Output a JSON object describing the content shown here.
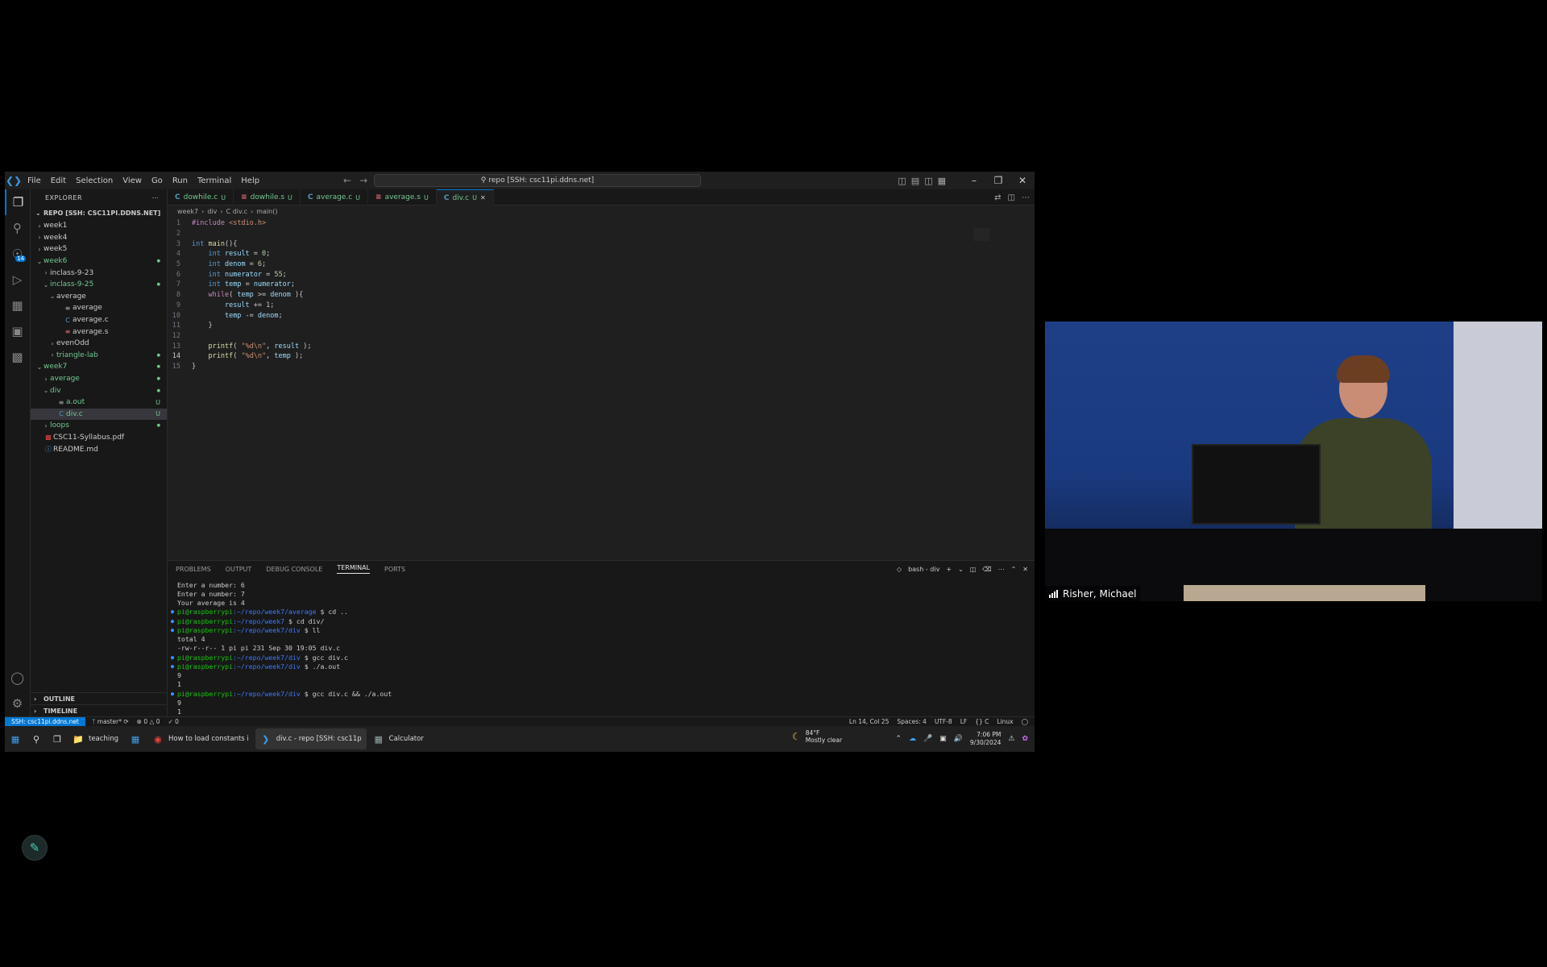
{
  "window": {
    "menu": [
      "File",
      "Edit",
      "Selection",
      "View",
      "Go",
      "Run",
      "Terminal",
      "Help"
    ],
    "command_center": "repo [SSH: csc11pi.ddns.net]"
  },
  "sidebar": {
    "header": "EXPLORER",
    "root": "REPO [SSH: CSC11PI.DDNS.NET]",
    "items": [
      {
        "label": "week1",
        "depth": 0,
        "type": "folder",
        "open": false,
        "status": "",
        "color": "default"
      },
      {
        "label": "week4",
        "depth": 0,
        "type": "folder",
        "open": false,
        "status": "",
        "color": "default"
      },
      {
        "label": "week5",
        "depth": 0,
        "type": "folder",
        "open": false,
        "status": "",
        "color": "default"
      },
      {
        "label": "week6",
        "depth": 0,
        "type": "folder",
        "open": true,
        "status": "●",
        "color": "green"
      },
      {
        "label": "inclass-9-23",
        "depth": 1,
        "type": "folder",
        "open": false,
        "status": "",
        "color": "default"
      },
      {
        "label": "inclass-9-25",
        "depth": 1,
        "type": "folder",
        "open": true,
        "status": "●",
        "color": "green"
      },
      {
        "label": "average",
        "depth": 2,
        "type": "folder",
        "open": true,
        "status": "",
        "color": "default"
      },
      {
        "label": "average",
        "depth": 3,
        "type": "bin",
        "open": false,
        "status": "",
        "color": "default"
      },
      {
        "label": "average.c",
        "depth": 3,
        "type": "c",
        "open": false,
        "status": "",
        "color": "default"
      },
      {
        "label": "average.s",
        "depth": 3,
        "type": "asm",
        "open": false,
        "status": "",
        "color": "default"
      },
      {
        "label": "evenOdd",
        "depth": 2,
        "type": "folder",
        "open": false,
        "status": "",
        "color": "default"
      },
      {
        "label": "triangle-lab",
        "depth": 2,
        "type": "folder",
        "open": false,
        "status": "●",
        "color": "green"
      },
      {
        "label": "week7",
        "depth": 0,
        "type": "folder",
        "open": true,
        "status": "●",
        "color": "green"
      },
      {
        "label": "average",
        "depth": 1,
        "type": "folder",
        "open": false,
        "status": "●",
        "color": "green"
      },
      {
        "label": "div",
        "depth": 1,
        "type": "folder",
        "open": true,
        "status": "●",
        "color": "green"
      },
      {
        "label": "a.out",
        "depth": 2,
        "type": "bin",
        "open": false,
        "status": "U",
        "color": "green"
      },
      {
        "label": "div.c",
        "depth": 2,
        "type": "c",
        "open": false,
        "status": "U",
        "color": "green",
        "selected": true
      },
      {
        "label": "loops",
        "depth": 1,
        "type": "folder",
        "open": false,
        "status": "●",
        "color": "green"
      },
      {
        "label": "CSC11-Syllabus.pdf",
        "depth": 0,
        "type": "pdf",
        "open": false,
        "status": "",
        "color": "default"
      },
      {
        "label": "README.md",
        "depth": 0,
        "type": "md",
        "open": false,
        "status": "",
        "color": "default"
      }
    ],
    "sections": [
      "OUTLINE",
      "TIMELINE"
    ]
  },
  "tabs": [
    {
      "icon": "C",
      "label": "dowhile.c",
      "status": "U",
      "active": false
    },
    {
      "icon": "asm",
      "label": "dowhile.s",
      "status": "U",
      "active": false
    },
    {
      "icon": "C",
      "label": "average.c",
      "status": "U",
      "active": false
    },
    {
      "icon": "asm",
      "label": "average.s",
      "status": "U",
      "active": false
    },
    {
      "icon": "C",
      "label": "div.c",
      "status": "U",
      "active": true
    }
  ],
  "breadcrumb": [
    "week7",
    "div",
    "C div.c",
    "main()"
  ],
  "code": {
    "current_line": 14,
    "lines": [
      "#include <stdio.h>",
      "",
      "int main(){",
      "    int result = 0;",
      "    int denom = 6;",
      "    int numerator = 55;",
      "    int temp = numerator;",
      "    while( temp >= denom ){",
      "        result += 1;",
      "        temp -= denom;",
      "    }",
      "",
      "    printf( \"%d\\n\", result );",
      "    printf( \"%d\\n\", temp );",
      "}"
    ]
  },
  "panel": {
    "tabs": [
      "PROBLEMS",
      "OUTPUT",
      "DEBUG CONSOLE",
      "TERMINAL",
      "PORTS"
    ],
    "active_tab": "TERMINAL",
    "terminal_name": "bash - div",
    "terminal": [
      {
        "type": "text",
        "text": "Enter a number: 6"
      },
      {
        "type": "text",
        "text": "Enter a number: 7"
      },
      {
        "type": "text",
        "text": "Your average is 4"
      },
      {
        "type": "prompt",
        "user": "pi@raspberrypi",
        "path": ":~/repo/week7/average",
        "cmd": " $ cd .."
      },
      {
        "type": "prompt",
        "user": "pi@raspberrypi",
        "path": ":~/repo/week7",
        "cmd": " $ cd div/"
      },
      {
        "type": "prompt",
        "user": "pi@raspberrypi",
        "path": ":~/repo/week7/div",
        "cmd": " $ ll"
      },
      {
        "type": "text",
        "text": "total 4"
      },
      {
        "type": "text",
        "text": "-rw-r--r-- 1 pi pi 231 Sep 30 19:05 div.c"
      },
      {
        "type": "prompt",
        "user": "pi@raspberrypi",
        "path": ":~/repo/week7/div",
        "cmd": " $ gcc div.c"
      },
      {
        "type": "prompt",
        "user": "pi@raspberrypi",
        "path": ":~/repo/week7/div",
        "cmd": " $ ./a.out"
      },
      {
        "type": "text",
        "text": "9"
      },
      {
        "type": "text",
        "text": "1"
      },
      {
        "type": "prompt",
        "user": "pi@raspberrypi",
        "path": ":~/repo/week7/div",
        "cmd": " $ gcc div.c && ./a.out"
      },
      {
        "type": "text",
        "text": "9"
      },
      {
        "type": "text",
        "text": "1"
      },
      {
        "type": "prompt_active",
        "user": "pi@raspberrypi",
        "path": ":~/repo/week7/div",
        "cmd": " $ "
      }
    ]
  },
  "statusbar": {
    "remote": "SSH: csc11pi.ddns.net",
    "branch": "master*",
    "errors": "0",
    "warnings": "0",
    "ports": "0",
    "position": "Ln 14, Col 25",
    "spaces": "Spaces: 4",
    "encoding": "UTF-8",
    "eol": "LF",
    "language": "C",
    "platform": "Linux"
  },
  "taskbar": {
    "apps": [
      {
        "icon": "folder-icon",
        "label": "teaching"
      },
      {
        "icon": "store-icon",
        "label": ""
      },
      {
        "icon": "chrome-icon",
        "label": "How to load constants i"
      },
      {
        "icon": "vscode-icon",
        "label": "div.c - repo [SSH: csc11p",
        "active": true
      },
      {
        "icon": "calculator-icon",
        "label": "Calculator"
      }
    ],
    "weather_temp": "84°F",
    "weather_desc": "Mostly clear",
    "time": "7:06 PM",
    "date": "9/30/2024"
  },
  "video": {
    "participant": "Risher, Michael"
  },
  "colors": {
    "accent": "#0078d4",
    "git_untracked": "#73c991",
    "keyword": "#569cd6",
    "string": "#ce9178"
  }
}
